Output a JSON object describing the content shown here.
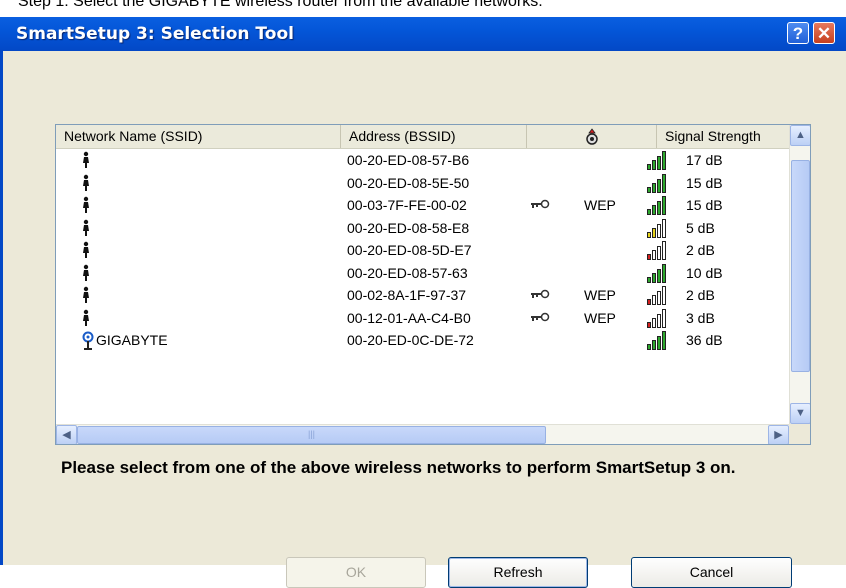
{
  "caption": "Step 1:   Select the GIGABYTE wireless router from the available networks.",
  "window": {
    "title": "SmartSetup 3: Selection Tool",
    "help_label": "?",
    "close_label": "✕"
  },
  "columns": {
    "ssid": "Network Name (SSID)",
    "bssid": "Address (BSSID)",
    "security_icon": "lock-key-icon",
    "signal": "Signal Strength"
  },
  "networks": [
    {
      "icon": "network-person-icon",
      "ssid": "",
      "bssid": "00-20-ED-08-57-B6",
      "locked": false,
      "encryption": "",
      "signal_level": "green",
      "signal": "17 dB"
    },
    {
      "icon": "network-person-icon",
      "ssid": "",
      "bssid": "00-20-ED-08-5E-50",
      "locked": false,
      "encryption": "",
      "signal_level": "green",
      "signal": "15 dB"
    },
    {
      "icon": "network-person-icon",
      "ssid": "",
      "bssid": "00-03-7F-FE-00-02",
      "locked": true,
      "encryption": "WEP",
      "signal_level": "green",
      "signal": "15 dB"
    },
    {
      "icon": "network-person-icon",
      "ssid": "",
      "bssid": "00-20-ED-08-58-E8",
      "locked": false,
      "encryption": "",
      "signal_level": "yellow",
      "signal": "5 dB"
    },
    {
      "icon": "network-person-icon",
      "ssid": "",
      "bssid": "00-20-ED-08-5D-E7",
      "locked": false,
      "encryption": "",
      "signal_level": "red",
      "signal": "2 dB"
    },
    {
      "icon": "network-person-icon",
      "ssid": "",
      "bssid": "00-20-ED-08-57-63",
      "locked": false,
      "encryption": "",
      "signal_level": "green",
      "signal": "10 dB"
    },
    {
      "icon": "network-person-icon",
      "ssid": "",
      "bssid": "00-02-8A-1F-97-37",
      "locked": true,
      "encryption": "WEP",
      "signal_level": "red",
      "signal": "2 dB"
    },
    {
      "icon": "network-person-icon",
      "ssid": "",
      "bssid": "00-12-01-AA-C4-B0",
      "locked": true,
      "encryption": "WEP",
      "signal_level": "red",
      "signal": "3 dB"
    },
    {
      "icon": "router-antenna-icon",
      "ssid": "GIGABYTE",
      "bssid": "00-20-ED-0C-DE-72",
      "locked": false,
      "encryption": "",
      "signal_level": "green",
      "signal": "36 dB"
    }
  ],
  "signal_colors": {
    "green": "#2ea82e",
    "yellow": "#e6d31c",
    "red": "#d42020",
    "empty": "#ffffff"
  },
  "message": "Please select from one of the above wireless networks to perform SmartSetup 3 on.",
  "buttons": {
    "ok": "OK",
    "refresh": "Refresh",
    "cancel": "Cancel"
  }
}
